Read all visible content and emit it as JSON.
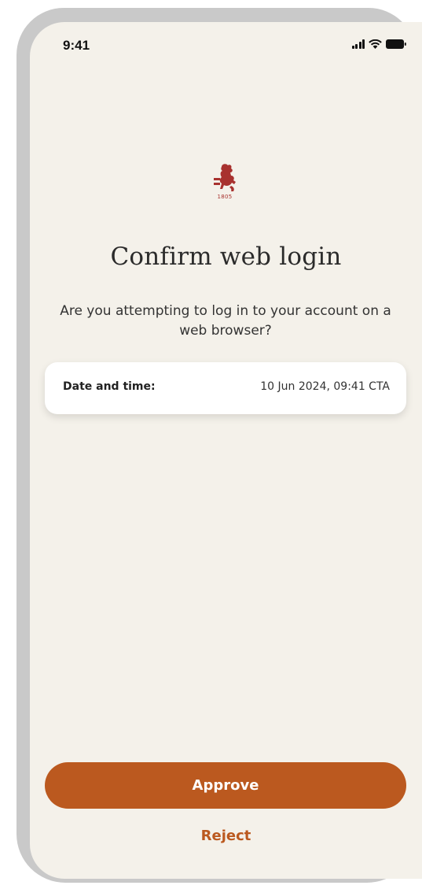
{
  "status_bar": {
    "time": "9:41",
    "icons": [
      "signal-icon",
      "wifi-icon",
      "battery-icon"
    ]
  },
  "logo": {
    "icon": "lion-crest-icon",
    "year": "1805",
    "color": "#a8322f"
  },
  "main": {
    "title": "Confirm web login",
    "subtitle": "Are you attempting to log in to your account on a web browser?"
  },
  "details": {
    "label": "Date and time:",
    "value": "10 Jun 2024, 09:41 CTA"
  },
  "actions": {
    "approve_label": "Approve",
    "reject_label": "Reject",
    "accent_color": "#bb591f"
  },
  "theme": {
    "background": "#f4f1ea",
    "frame": "#c9c9c9"
  }
}
